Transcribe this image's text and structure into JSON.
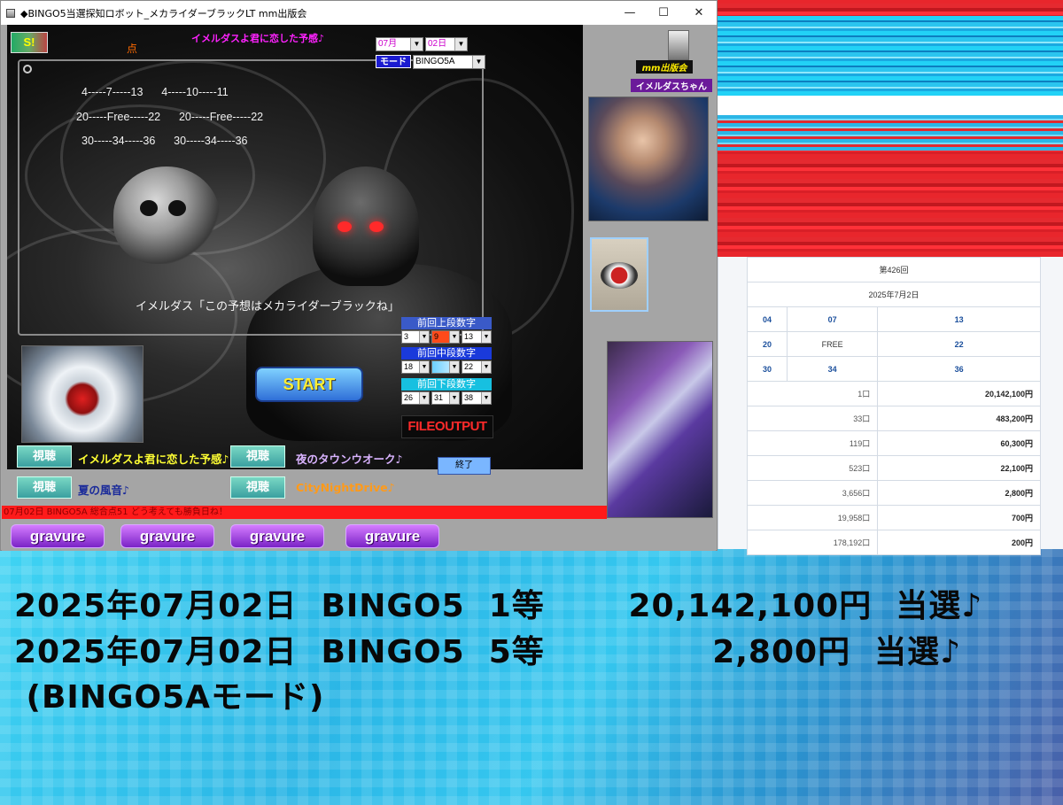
{
  "window": {
    "title": "◆BINGO5当選探知ロボット_メカライダーブラックLT  mm出版会",
    "minimize": "—",
    "maximize": "☐",
    "close": "✕"
  },
  "app": {
    "logo_text": "S!",
    "dot_label": "点",
    "song_title": "イメルダスよ君に恋した予感♪",
    "month": "07月",
    "day": "02日",
    "mode_label": "モード",
    "mode_value": "BINGO5A",
    "publisher_badge": "mm出版会",
    "character_badge": "イメルダスちゃん",
    "grid_rows": [
      "4-----7-----13      4-----10-----11",
      "20-----Free-----22      20-----Free-----22",
      "30-----34-----36      30-----34-----36"
    ],
    "caption": "イメルダス「この予想はメカライダーブラックね」",
    "prev_upper_label": "前回上段数字",
    "prev_upper": [
      "3",
      "9",
      "13"
    ],
    "prev_middle_label": "前回中段数字",
    "prev_middle": [
      "18",
      "",
      "22"
    ],
    "prev_lower_label": "前回下段数字",
    "prev_lower": [
      "26",
      "31",
      "38"
    ],
    "start_label": "START",
    "fileoutput_label": "FILEOUTPUT",
    "end_label": "終了",
    "view_label": "視聴",
    "songs": [
      "イメルダスよ君に恋した予感♪",
      "夜のタウンウオーク♪",
      "夏の風音♪",
      "CityNightDrive♪"
    ],
    "status": "07月02日 BINGO5A  総合点51  どう考えても勝負日ね！",
    "gravure_label": "gravure"
  },
  "results": {
    "round": "第426回",
    "date": "2025年7月2日",
    "numbers": [
      [
        "04",
        "07",
        "13"
      ],
      [
        "20",
        "FREE",
        "22"
      ],
      [
        "30",
        "34",
        "36"
      ]
    ],
    "prizes": [
      {
        "count": "1口",
        "amount": "20,142,100円"
      },
      {
        "count": "33口",
        "amount": "483,200円"
      },
      {
        "count": "119口",
        "amount": "60,300円"
      },
      {
        "count": "523口",
        "amount": "22,100円"
      },
      {
        "count": "3,656口",
        "amount": "2,800円"
      },
      {
        "count": "19,958口",
        "amount": "700円"
      },
      {
        "count": "178,192口",
        "amount": "200円"
      }
    ]
  },
  "headline": {
    "line1": "2025年07月02日  BINGO5  1等       20,142,100円  当選♪",
    "line2": "2025年07月02日  BINGO5  5等              2,800円  当選♪",
    "line3": " (BINGO5Aモード)"
  },
  "colors": {
    "status_bar": "#ff1a1a",
    "song_yellow": "#ffff33",
    "song_lilac": "#d9b3ff",
    "song_orange": "#ff9a1a",
    "accent_magenta": "#ff22ff"
  }
}
